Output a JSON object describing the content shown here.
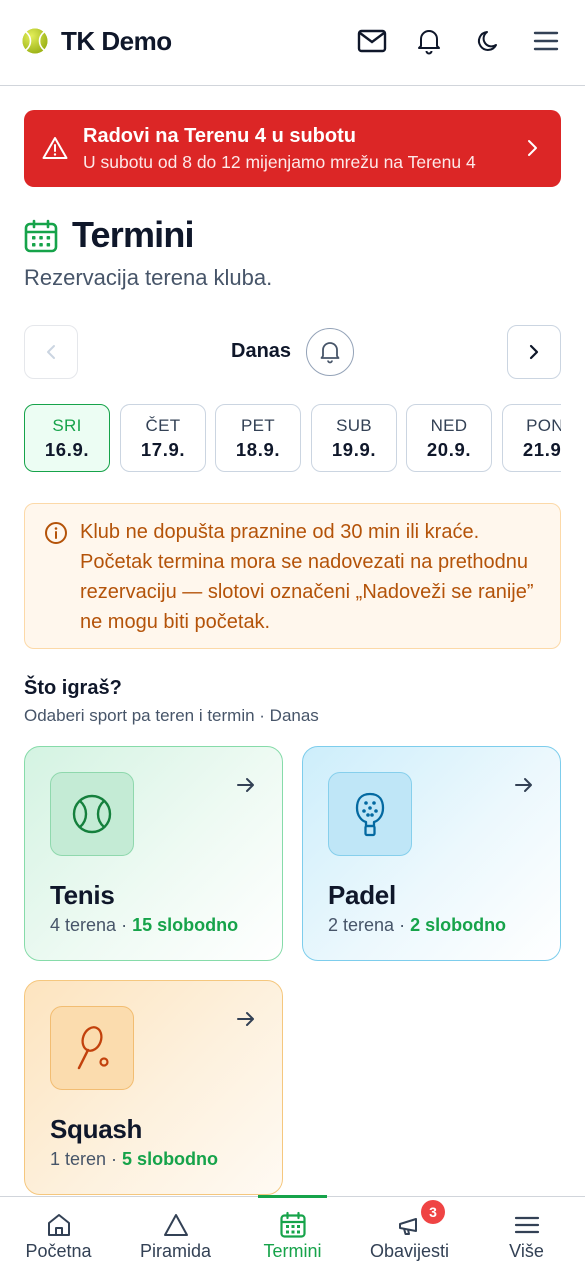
{
  "header": {
    "app_title": "TK Demo",
    "icons": [
      "tennis-ball-logo",
      "mail-icon",
      "bell-icon",
      "moon-icon",
      "menu-icon"
    ]
  },
  "banner": {
    "title": "Radovi na Terenu 4 u subotu",
    "text": "U subotu od 8 do 12 mijenjamo mrežu na Terenu 4",
    "color": "#dc2626"
  },
  "page": {
    "title": "Termini",
    "subtitle": "Rezervacija terena kluba."
  },
  "date_nav": {
    "label": "Danas"
  },
  "days": [
    {
      "name": "SRI",
      "date": "16.9.",
      "active": true
    },
    {
      "name": "ČET",
      "date": "17.9.",
      "active": false
    },
    {
      "name": "PET",
      "date": "18.9.",
      "active": false
    },
    {
      "name": "SUB",
      "date": "19.9.",
      "active": false
    },
    {
      "name": "NED",
      "date": "20.9.",
      "active": false
    },
    {
      "name": "PON",
      "date": "21.9.",
      "active": false
    }
  ],
  "info": {
    "text": "Klub ne dopušta praznine od 30 min ili kraće. Početak termina mora se nadovezati na prethodnu rezervaciju — slotovi označeni „Nadoveži se ranije” ne mogu biti početak."
  },
  "section": {
    "title": "Što igraš?",
    "subtitle": "Odaberi sport pa teren i termin · Danas"
  },
  "sports": [
    {
      "name": "Tenis",
      "courts": "4 terena",
      "sep": " · ",
      "free": "15 slobodno",
      "accent": "#16a34a"
    },
    {
      "name": "Padel",
      "courts": "2 terena",
      "sep": " · ",
      "free": "2 slobodno",
      "accent": "#0284c7"
    },
    {
      "name": "Squash",
      "courts": "1 teren",
      "sep": " · ",
      "free": "5 slobodno",
      "accent": "#c2410c"
    }
  ],
  "bottom_nav": [
    {
      "label": "Početna",
      "icon": "home-icon",
      "active": false
    },
    {
      "label": "Piramida",
      "icon": "triangle-icon",
      "active": false
    },
    {
      "label": "Termini",
      "icon": "calendar-icon",
      "active": true
    },
    {
      "label": "Obavijesti",
      "icon": "megaphone-icon",
      "active": false,
      "badge": "3"
    },
    {
      "label": "Više",
      "icon": "menu-icon",
      "active": false
    }
  ]
}
